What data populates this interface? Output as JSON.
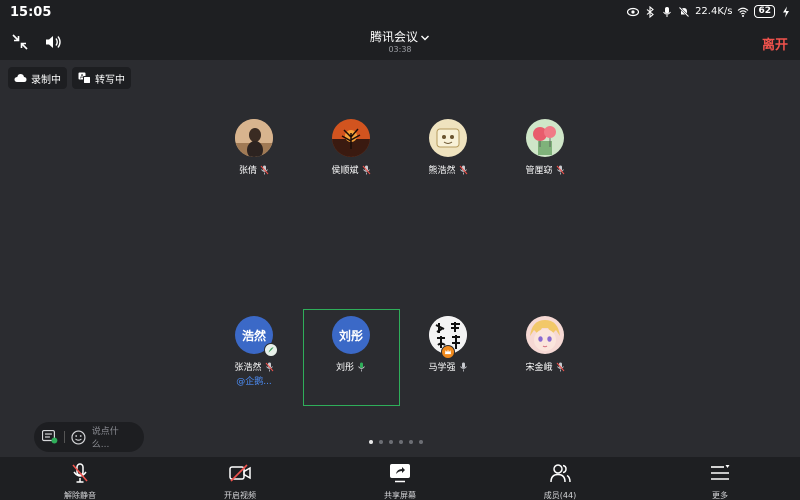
{
  "status_bar": {
    "time": "15:05",
    "net_speed": "22.4K/s",
    "battery": "62"
  },
  "header": {
    "title": "腾讯会议",
    "timer": "03:38",
    "leave_label": "离开"
  },
  "chips": {
    "recording": "录制中",
    "transcribing": "转写中"
  },
  "participants": [
    {
      "name": "张倩",
      "avatar": "photo-woman"
    },
    {
      "name": "侯顺斌",
      "avatar": "photo-sunset"
    },
    {
      "name": "熊浩然",
      "avatar": "photo-cartoon"
    },
    {
      "name": "管厘窈",
      "avatar": "photo-balloons"
    },
    {
      "name": "张浩然",
      "avatar_text": "浩然",
      "company": "@企鹅..."
    },
    {
      "name": "刘彤",
      "avatar_text": "刘彤",
      "speaking": true
    },
    {
      "name": "马学强",
      "avatar": "calligraphy",
      "host": true
    },
    {
      "name": "宋金峨",
      "avatar": "anime-girl"
    }
  ],
  "chat": {
    "placeholder": "说点什么..."
  },
  "pager": {
    "pages": 6,
    "current": 1
  },
  "toolbar": {
    "unmute": "解除静音",
    "start_video": "开启视频",
    "share_screen": "共享屏幕",
    "members": "成员(44)",
    "more": "更多"
  },
  "colors": {
    "leave": "#f0524c",
    "speaking_border": "#2fae5a",
    "avatar_blue": "#3b69c7",
    "company_link": "#4d8ef7"
  }
}
